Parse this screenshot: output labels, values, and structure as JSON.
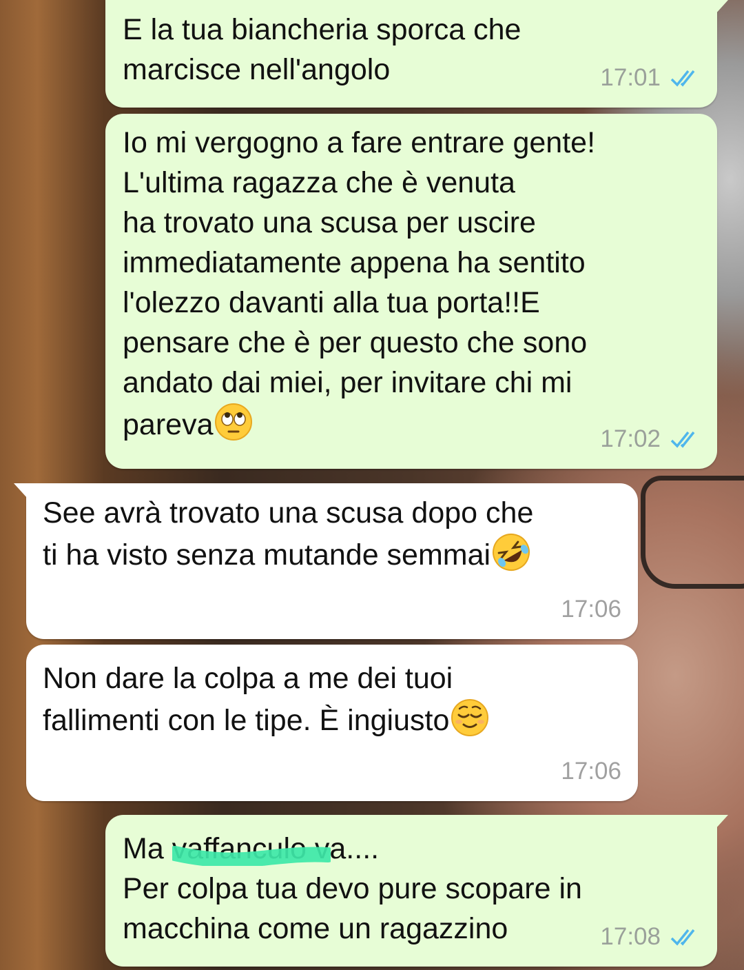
{
  "chat": {
    "messages": [
      {
        "direction": "outgoing",
        "text": "E la tua biancheria sporca che\nmarcisce nell'angolo",
        "time": "17:01",
        "status": "read"
      },
      {
        "direction": "outgoing",
        "text": "Io mi vergogno a fare entrare gente!\nL'ultima ragazza che è venuta\nha trovato una scusa per uscire\nimmediatamente appena ha sentito\nl'olezzo davanti alla tua porta!!E\npensare che è per questo che sono\nandato dai miei, per invitare chi mi\npareva",
        "emoji": "face-with-rolling-eyes",
        "time": "17:02",
        "status": "read"
      },
      {
        "direction": "incoming",
        "text": "See avrà trovato una scusa dopo che\nti ha visto senza mutande semmai",
        "emoji": "rolling-on-the-floor-laughing",
        "time": "17:06"
      },
      {
        "direction": "incoming",
        "text": "Non dare la colpa a me dei tuoi\nfallimenti con le tipe. È ingiusto",
        "emoji": "relieved-face",
        "time": "17:06"
      },
      {
        "direction": "outgoing",
        "text_before": "Ma ",
        "text_censored": "vaffanculo",
        "text_after": " va....\nPer colpa tua devo pure scopare in\nmacchina come un ragazzino",
        "censor_mark": "scribble",
        "time": "17:08",
        "status": "read"
      }
    ]
  },
  "colors": {
    "outgoing_bubble": "#e7fdd6",
    "incoming_bubble": "#ffffff",
    "read_ticks": "#4fb6ec",
    "timestamp": "#9aa09a",
    "censor_scribble": "#3ee8a8"
  }
}
